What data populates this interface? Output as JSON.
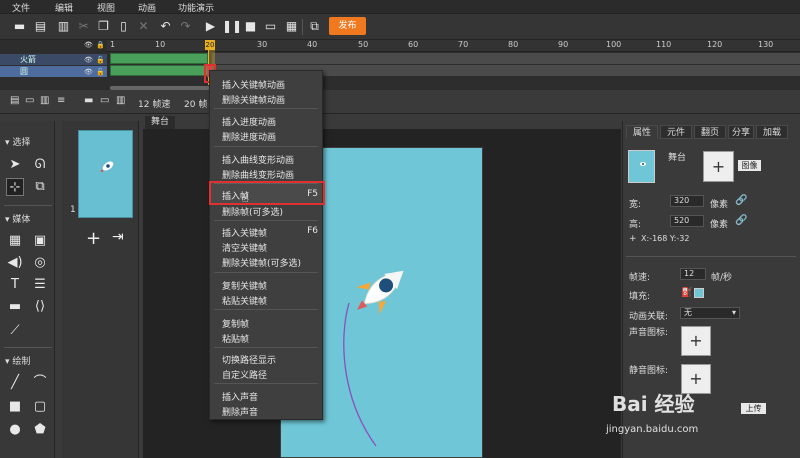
{
  "menubar": {
    "items": [
      "文件",
      "编辑",
      "视图",
      "动画",
      "功能演示"
    ]
  },
  "toolbar": {
    "publish_label": "发布"
  },
  "timeline": {
    "ruler": [
      "1",
      "10",
      "20",
      "30",
      "40",
      "50",
      "60",
      "70",
      "80",
      "90",
      "100",
      "110",
      "120",
      "130"
    ],
    "playhead_label": "20",
    "layers": [
      {
        "name": "火箭"
      },
      {
        "name": "圆"
      }
    ],
    "fps_label": "12 帧速",
    "frames_label": "20 帧"
  },
  "tools": {
    "section_select": "选择",
    "section_media": "媒体",
    "section_draw": "绘制"
  },
  "scenes": {
    "number": "1"
  },
  "stage": {
    "tab_label": "舞台"
  },
  "context_menu": {
    "items": [
      {
        "label": "插入关键帧动画",
        "key": ""
      },
      {
        "label": "删除关键帧动画",
        "key": ""
      },
      {
        "label": "插入进度动画",
        "key": ""
      },
      {
        "label": "删除进度动画",
        "key": ""
      },
      {
        "label": "插入曲线变形动画",
        "key": ""
      },
      {
        "label": "删除曲线变形动画",
        "key": ""
      },
      {
        "label": "插入帧",
        "key": "F5"
      },
      {
        "label": "删除帧(可多选)",
        "key": ""
      },
      {
        "label": "插入关键帧",
        "key": "F6"
      },
      {
        "label": "清空关键帧",
        "key": ""
      },
      {
        "label": "删除关键帧(可多选)",
        "key": ""
      },
      {
        "label": "复制关键帧",
        "key": ""
      },
      {
        "label": "粘贴关键帧",
        "key": ""
      },
      {
        "label": "复制帧",
        "key": ""
      },
      {
        "label": "粘贴帧",
        "key": ""
      },
      {
        "label": "切换路径显示",
        "key": ""
      },
      {
        "label": "自定义路径",
        "key": ""
      },
      {
        "label": "插入声音",
        "key": ""
      },
      {
        "label": "删除声音",
        "key": ""
      }
    ]
  },
  "properties": {
    "tabs": [
      "属性",
      "元件",
      "翻页",
      "分享",
      "加载"
    ],
    "stage_label": "舞台",
    "image_button": "图像",
    "width_label": "宽:",
    "width_value": "320",
    "height_label": "高:",
    "height_value": "520",
    "unit": "像素",
    "coords": "X:-168  Y:-32",
    "fps_label": "帧速:",
    "fps_value": "12",
    "fps_unit": "帧/秒",
    "fill_label": "填充:",
    "anim_label": "动画关联:",
    "anim_value": "无",
    "sound_icon_label": "声音图标:",
    "mute_icon_label": "静音图标:",
    "upload_label": "上传"
  },
  "watermark": {
    "main": "Bai 经验",
    "sub": "jingyan.baidu.com"
  },
  "colors": {
    "accent": "#f0781e",
    "stage_bg": "#6ec6d6",
    "highlight": "#e03030"
  }
}
